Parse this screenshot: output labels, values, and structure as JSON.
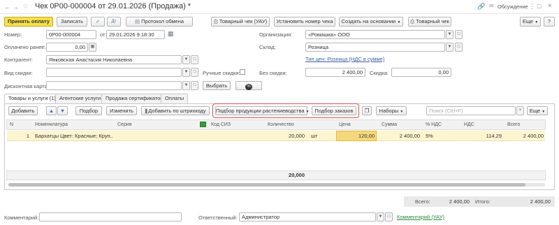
{
  "window": {
    "title": "Чек 0Р00-000004 от 29.01.2026 (Продажа) *",
    "discussion": "Обсуждение"
  },
  "toolbar": {
    "accept_payment": "Принять оплату",
    "record": "Записать",
    "exchange_log": "Протокол обмена",
    "goods_receipt": "Товарный чек (УАУ)",
    "set_number": "Установить номер чека",
    "create_based": "Создать на основании",
    "goods_receipt2": "Товарный чек",
    "more": "Еще",
    "help": "?"
  },
  "header": {
    "number_label": "Номер:",
    "number_value": "0Р00-000004",
    "date_label": "от:",
    "date_value": "29.01.2026  9:18:30",
    "org_label": "Организация:",
    "org_value": "«Ромашка» ООО",
    "prepaid_label": "Оплачено ранее:",
    "prepaid_value": "0,00",
    "warehouse_label": "Склад:",
    "warehouse_value": "Розница",
    "price_type_link": "Тип цен: Розница (НДС в сумме)",
    "counterparty_label": "Контрагент:",
    "counterparty_value": "Янковская Анастасия Николаевна",
    "discount_type_label": "Вид скидки:",
    "manual_discount_label": "Ручные скидки:",
    "no_discount_label": "Без скидки:",
    "no_discount_value": "2 400,00",
    "discount_label": "Скидка:",
    "discount_value": "0,00",
    "discount_card_label": "Дисконтная карта:",
    "select_button": "Выбрать"
  },
  "tabs": [
    "Товары и услуги (1)",
    "Агентские услуги",
    "Продажа сертификатов",
    "Оплаты"
  ],
  "table_toolbar": {
    "add": "Добавить",
    "selection": "Подбор",
    "change": "Изменить",
    "add_barcode": "Добавить по штрихкоду",
    "plant_selection": "Подбор продукции растениеводства",
    "order_selection": "Подбор заказов",
    "kits": "Наборы",
    "search_placeholder": "Поиск (Ctrl+F)",
    "more": "Еще"
  },
  "table": {
    "columns": [
      "N",
      "Номенклатура",
      "Серия",
      "Код СИЗ",
      "Количество",
      "Цена",
      "Сумма",
      "% НДС",
      "НДС",
      "Всего"
    ],
    "rows": [
      {
        "n": "1",
        "item": "Бархатцы Цвет: Красные; Круп...",
        "series": "",
        "code": "",
        "qty": "20,000",
        "unit": "шт",
        "price": "120,00",
        "sum": "2 400,00",
        "vat_rate": "5%",
        "vat": "114,29",
        "total": "2 400,00"
      }
    ],
    "footer_qty": "20,000"
  },
  "totals": {
    "total_label": "Всего:",
    "total_value": "2 400,00",
    "result_label": "Итого:",
    "result_value": "2 400,00"
  },
  "footer": {
    "comment_label": "Комментарий:",
    "responsible_label": "Ответственный:",
    "responsible_value": "Администратор",
    "comment_link": "Комментарий (УАУ)"
  }
}
